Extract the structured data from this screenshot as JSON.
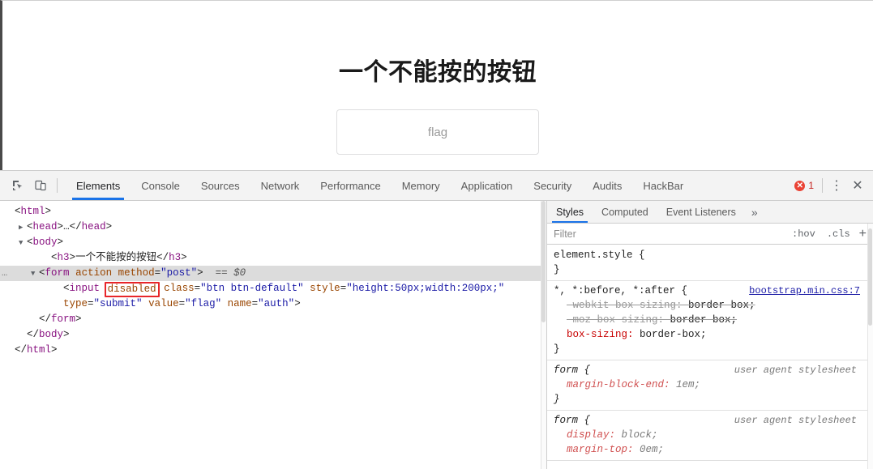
{
  "page": {
    "heading": "一个不能按的按钮",
    "button_label": "flag"
  },
  "devtools": {
    "icons": {
      "inspect": "inspect-element-icon",
      "device": "device-toolbar-icon"
    },
    "tabs": [
      {
        "label": "Elements",
        "active": true
      },
      {
        "label": "Console",
        "active": false
      },
      {
        "label": "Sources",
        "active": false
      },
      {
        "label": "Network",
        "active": false
      },
      {
        "label": "Performance",
        "active": false
      },
      {
        "label": "Memory",
        "active": false
      },
      {
        "label": "Application",
        "active": false
      },
      {
        "label": "Security",
        "active": false
      },
      {
        "label": "Audits",
        "active": false
      },
      {
        "label": "HackBar",
        "active": false
      }
    ],
    "error_count": "1",
    "error_color": "#ea4335",
    "accent_color": "#1a73e8",
    "menu_glyph": "⋮",
    "close_glyph": "✕"
  },
  "dom": {
    "rows": [
      {
        "indent": 0,
        "twisty": "",
        "selected": false,
        "parts": [
          {
            "t": "punct",
            "s": "<"
          },
          {
            "t": "tag",
            "s": "html"
          },
          {
            "t": "punct",
            "s": ">"
          }
        ]
      },
      {
        "indent": 1,
        "twisty": "▶",
        "selected": false,
        "parts": [
          {
            "t": "punct",
            "s": "<"
          },
          {
            "t": "tag",
            "s": "head"
          },
          {
            "t": "punct",
            "s": ">"
          },
          {
            "t": "text",
            "s": "…"
          },
          {
            "t": "punct",
            "s": "</"
          },
          {
            "t": "tag",
            "s": "head"
          },
          {
            "t": "punct",
            "s": ">"
          }
        ]
      },
      {
        "indent": 1,
        "twisty": "▼",
        "selected": false,
        "parts": [
          {
            "t": "punct",
            "s": "<"
          },
          {
            "t": "tag",
            "s": "body"
          },
          {
            "t": "punct",
            "s": ">"
          }
        ]
      },
      {
        "indent": 3,
        "twisty": "",
        "selected": false,
        "parts": [
          {
            "t": "punct",
            "s": "<"
          },
          {
            "t": "tag",
            "s": "h3"
          },
          {
            "t": "punct",
            "s": ">"
          },
          {
            "t": "text",
            "s": "一个不能按的按钮"
          },
          {
            "t": "punct",
            "s": "</"
          },
          {
            "t": "tag",
            "s": "h3"
          },
          {
            "t": "punct",
            "s": ">"
          }
        ]
      },
      {
        "indent": 2,
        "twisty": "▼",
        "selected": true,
        "ellipsis": "…",
        "parts": [
          {
            "t": "punct",
            "s": "<"
          },
          {
            "t": "tag",
            "s": "form"
          },
          {
            "t": "text",
            "s": " "
          },
          {
            "t": "attr-name",
            "s": "action"
          },
          {
            "t": "text",
            "s": " "
          },
          {
            "t": "attr-name",
            "s": "method"
          },
          {
            "t": "punct",
            "s": "="
          },
          {
            "t": "attr-val",
            "s": "\"post\""
          },
          {
            "t": "punct",
            "s": ">"
          },
          {
            "t": "sel",
            "s": "  == $0"
          }
        ]
      },
      {
        "indent": 4,
        "twisty": "",
        "selected": false,
        "parts": [
          {
            "t": "punct",
            "s": "<"
          },
          {
            "t": "tag",
            "s": "input"
          },
          {
            "t": "text",
            "s": " "
          },
          {
            "t": "boxed-attr",
            "s": "disabled"
          },
          {
            "t": "text",
            "s": " "
          },
          {
            "t": "attr-name",
            "s": "class"
          },
          {
            "t": "punct",
            "s": "="
          },
          {
            "t": "attr-val",
            "s": "\"btn btn-default\""
          },
          {
            "t": "text",
            "s": " "
          },
          {
            "t": "attr-name",
            "s": "style"
          },
          {
            "t": "punct",
            "s": "="
          },
          {
            "t": "attr-val",
            "s": "\"height:50px;width:200px;\""
          }
        ]
      },
      {
        "indent": 4,
        "twisty": "",
        "selected": false,
        "parts": [
          {
            "t": "attr-name",
            "s": "type"
          },
          {
            "t": "punct",
            "s": "="
          },
          {
            "t": "attr-val",
            "s": "\"submit\""
          },
          {
            "t": "text",
            "s": " "
          },
          {
            "t": "attr-name",
            "s": "value"
          },
          {
            "t": "punct",
            "s": "="
          },
          {
            "t": "attr-val",
            "s": "\"flag\""
          },
          {
            "t": "text",
            "s": " "
          },
          {
            "t": "attr-name",
            "s": "name"
          },
          {
            "t": "punct",
            "s": "="
          },
          {
            "t": "attr-val",
            "s": "\"auth\""
          },
          {
            "t": "punct",
            "s": ">"
          }
        ]
      },
      {
        "indent": 2,
        "twisty": "",
        "selected": false,
        "parts": [
          {
            "t": "punct",
            "s": "</"
          },
          {
            "t": "tag",
            "s": "form"
          },
          {
            "t": "punct",
            "s": ">"
          }
        ]
      },
      {
        "indent": 1,
        "twisty": "",
        "selected": false,
        "parts": [
          {
            "t": "punct",
            "s": "</"
          },
          {
            "t": "tag",
            "s": "body"
          },
          {
            "t": "punct",
            "s": ">"
          }
        ]
      },
      {
        "indent": 0,
        "twisty": "",
        "selected": false,
        "parts": [
          {
            "t": "punct",
            "s": "</"
          },
          {
            "t": "tag",
            "s": "html"
          },
          {
            "t": "punct",
            "s": ">"
          }
        ]
      }
    ]
  },
  "styles": {
    "tabs": [
      {
        "label": "Styles",
        "active": true
      },
      {
        "label": "Computed",
        "active": false
      },
      {
        "label": "Event Listeners",
        "active": false
      }
    ],
    "more_glyph": "»",
    "filter_placeholder": "Filter",
    "filter_value": "",
    "hov_label": ":hov",
    "cls_label": ".cls",
    "plus_label": "+",
    "rules": [
      {
        "selector": "element.style {",
        "origin": "",
        "origin_link": "",
        "declarations": [],
        "close": "}"
      },
      {
        "selector": "*, *:before, *:after {",
        "origin": "",
        "origin_link": "bootstrap.min.css:7",
        "declarations": [
          {
            "prop": "-webkit-box-sizing",
            "value": "border-box;",
            "struck": true
          },
          {
            "prop": "-moz-box-sizing",
            "value": "border-box;",
            "struck": true
          },
          {
            "prop": "box-sizing",
            "value": "border-box;",
            "struck": false
          }
        ],
        "close": "}"
      },
      {
        "selector": "form {",
        "origin": "user agent stylesheet",
        "origin_link": "",
        "ua": true,
        "declarations": [
          {
            "prop": "margin-block-end",
            "value": "1em;",
            "struck": false
          }
        ],
        "close": "}"
      },
      {
        "selector": "form {",
        "origin": "user agent stylesheet",
        "origin_link": "",
        "ua": true,
        "declarations": [
          {
            "prop": "display",
            "value": "block;",
            "struck": false
          },
          {
            "prop": "margin-top",
            "value": "0em;",
            "struck": false
          }
        ],
        "close": ""
      }
    ]
  }
}
